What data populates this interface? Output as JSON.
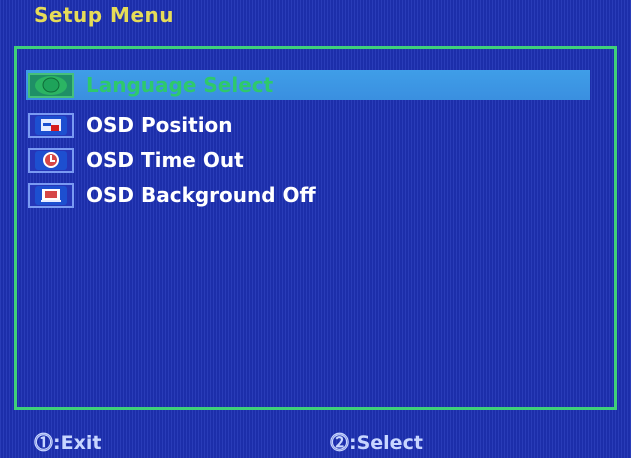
{
  "title": "Setup Menu",
  "menu": {
    "items": [
      {
        "label": "Language Select",
        "icon": "language-icon",
        "selected": true
      },
      {
        "label": "OSD Position",
        "icon": "position-icon",
        "selected": false
      },
      {
        "label": "OSD Time Out",
        "icon": "timer-icon",
        "selected": false
      },
      {
        "label": "OSD Background Off",
        "icon": "background-icon",
        "selected": false
      }
    ]
  },
  "footer": {
    "exit": "⓵:Exit",
    "select": "⓶:Select"
  },
  "colors": {
    "background": "#1e31b4",
    "title": "#e6dc58",
    "border": "#3fd07a",
    "highlight": "#3f9ee8",
    "selected_text": "#2ec96c"
  }
}
